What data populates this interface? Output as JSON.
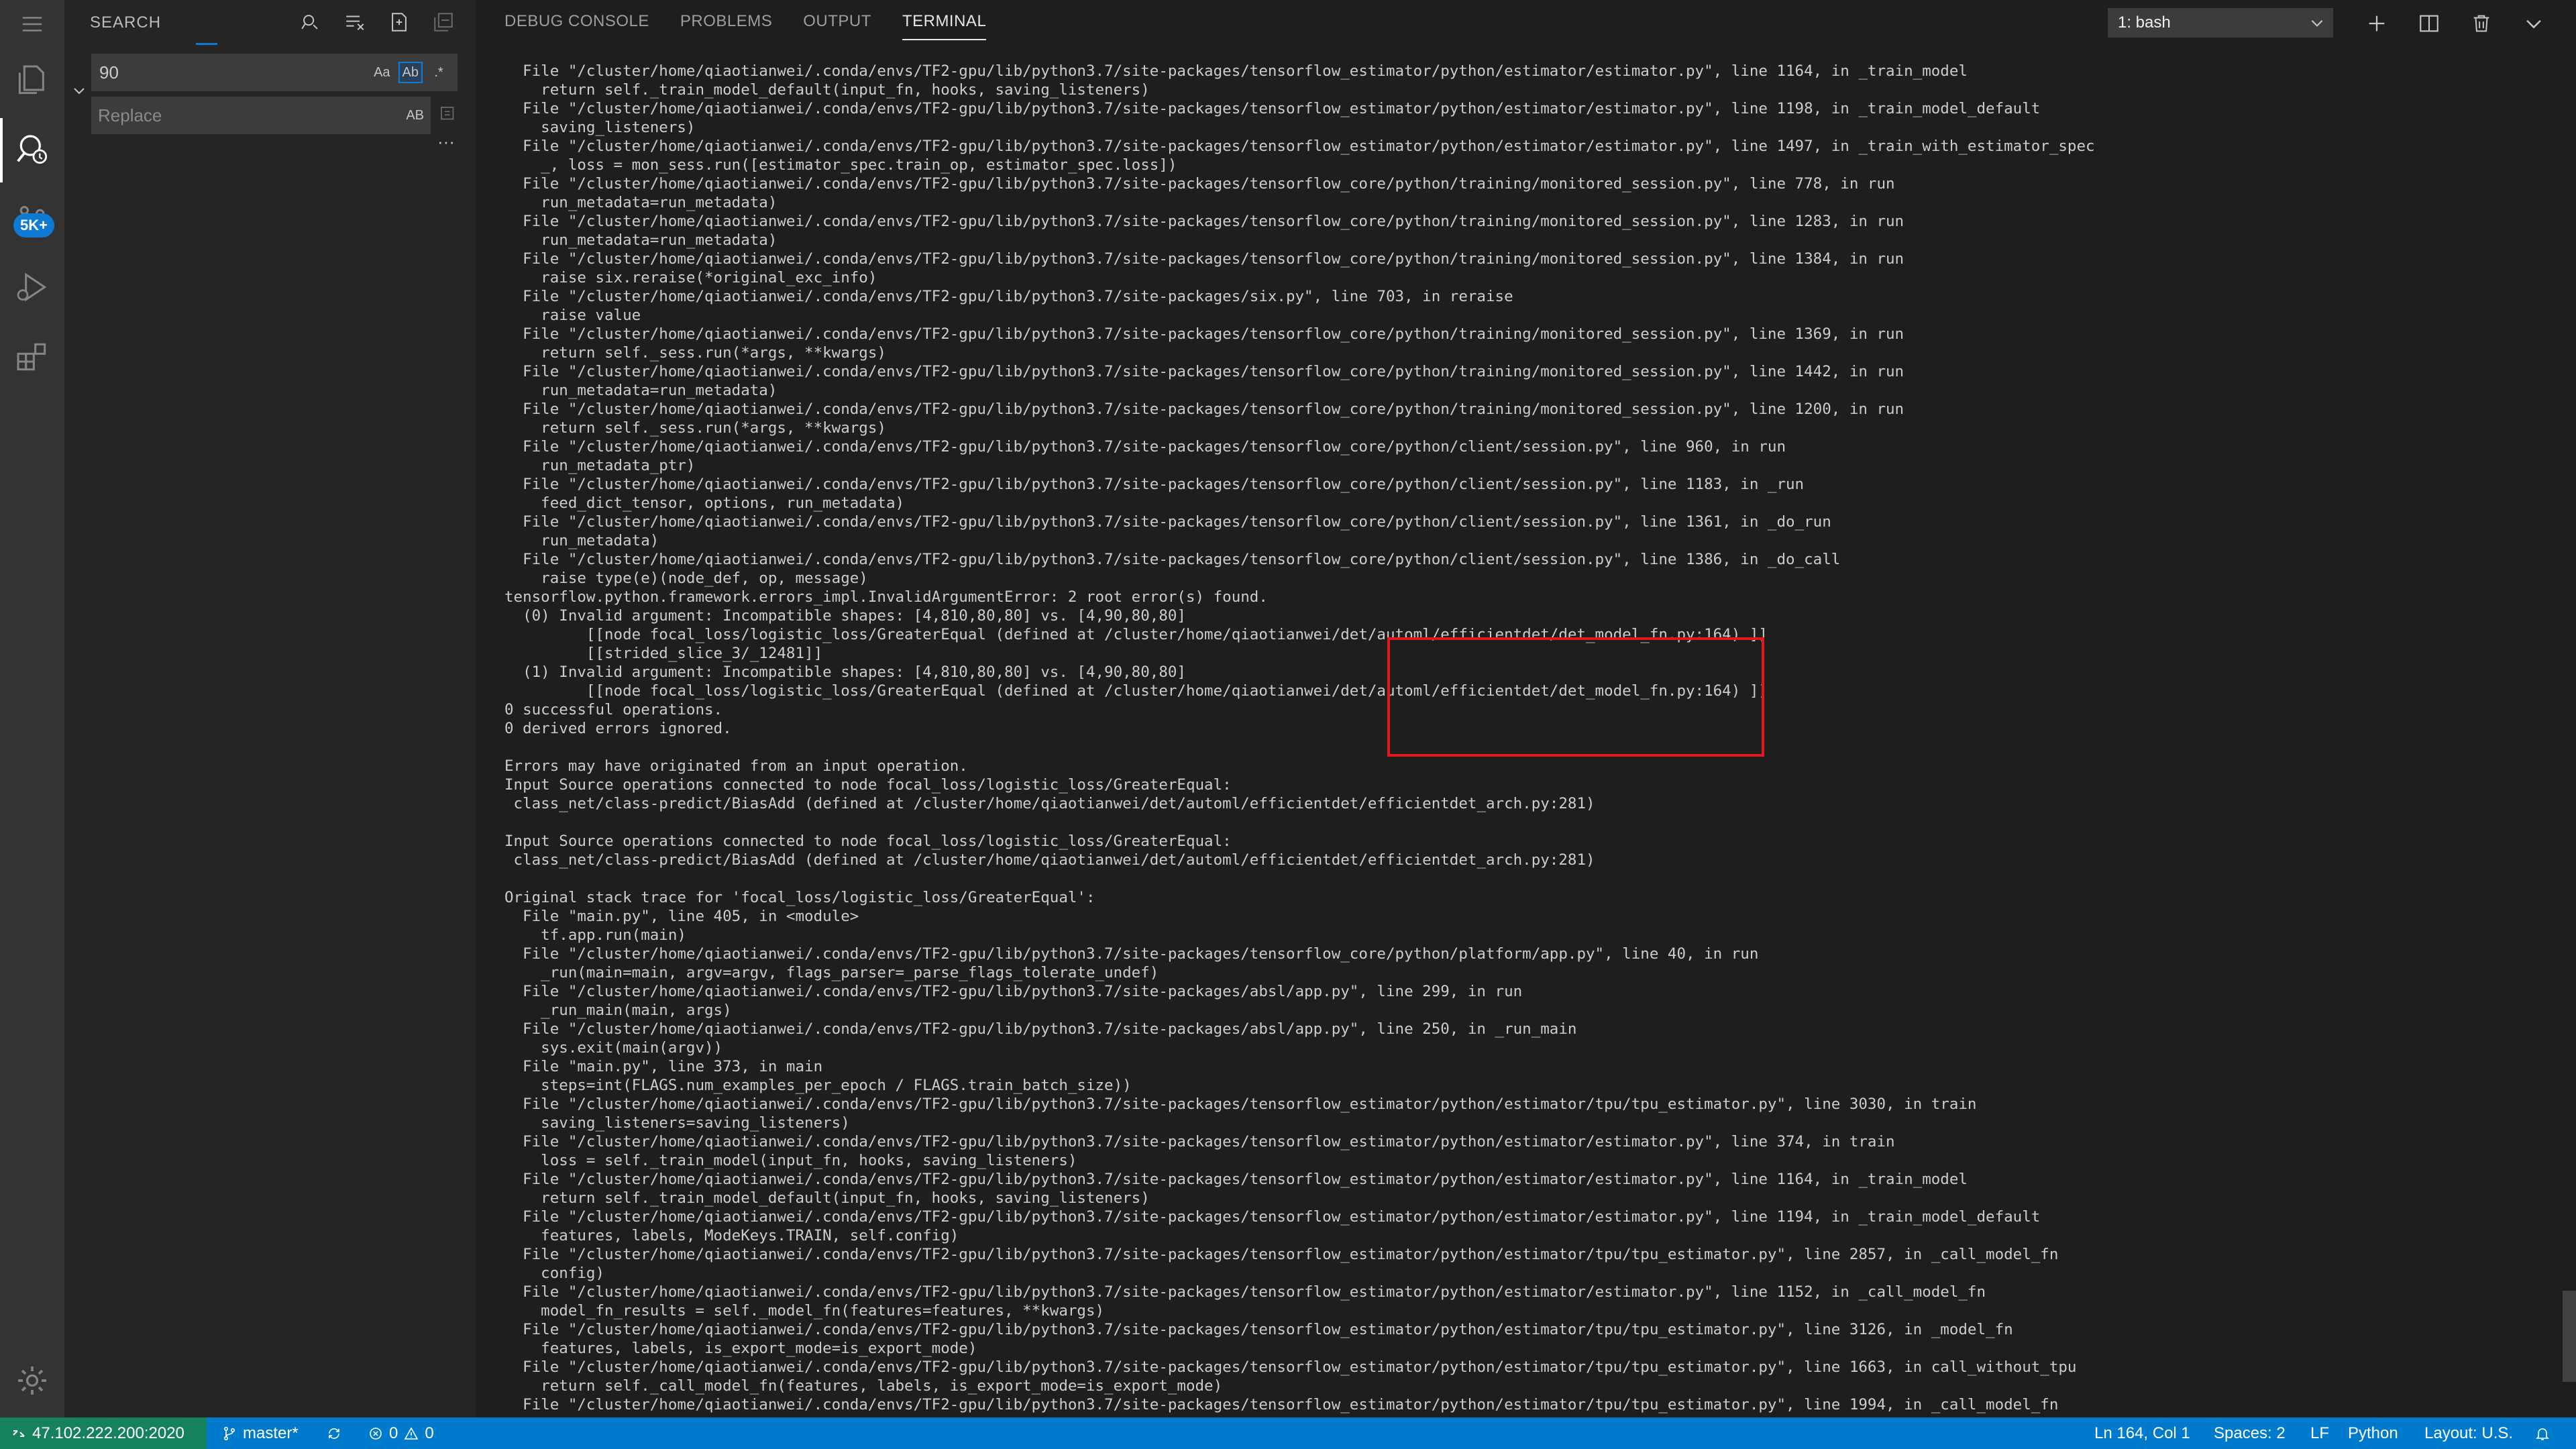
{
  "sidebar": {
    "title": "SEARCH",
    "search_value": "90",
    "replace_placeholder": "Replace",
    "options": {
      "match_case": "Aa",
      "whole_word": "Ab",
      "regex": ".*"
    },
    "replace_all": "AB",
    "more": "···"
  },
  "activity_bar": {
    "badge": "5K+"
  },
  "panel": {
    "tabs": [
      "DEBUG CONSOLE",
      "PROBLEMS",
      "OUTPUT",
      "TERMINAL"
    ],
    "active_tab": "TERMINAL",
    "terminal_select": "1: bash"
  },
  "terminal": {
    "lines": [
      "  File \"/cluster/home/qiaotianwei/.conda/envs/TF2-gpu/lib/python3.7/site-packages/tensorflow_estimator/python/estimator/estimator.py\", line 1164, in _train_model",
      "    return self._train_model_default(input_fn, hooks, saving_listeners)",
      "  File \"/cluster/home/qiaotianwei/.conda/envs/TF2-gpu/lib/python3.7/site-packages/tensorflow_estimator/python/estimator/estimator.py\", line 1198, in _train_model_default",
      "    saving_listeners)",
      "  File \"/cluster/home/qiaotianwei/.conda/envs/TF2-gpu/lib/python3.7/site-packages/tensorflow_estimator/python/estimator/estimator.py\", line 1497, in _train_with_estimator_spec",
      "    _, loss = mon_sess.run([estimator_spec.train_op, estimator_spec.loss])",
      "  File \"/cluster/home/qiaotianwei/.conda/envs/TF2-gpu/lib/python3.7/site-packages/tensorflow_core/python/training/monitored_session.py\", line 778, in run",
      "    run_metadata=run_metadata)",
      "  File \"/cluster/home/qiaotianwei/.conda/envs/TF2-gpu/lib/python3.7/site-packages/tensorflow_core/python/training/monitored_session.py\", line 1283, in run",
      "    run_metadata=run_metadata)",
      "  File \"/cluster/home/qiaotianwei/.conda/envs/TF2-gpu/lib/python3.7/site-packages/tensorflow_core/python/training/monitored_session.py\", line 1384, in run",
      "    raise six.reraise(*original_exc_info)",
      "  File \"/cluster/home/qiaotianwei/.conda/envs/TF2-gpu/lib/python3.7/site-packages/six.py\", line 703, in reraise",
      "    raise value",
      "  File \"/cluster/home/qiaotianwei/.conda/envs/TF2-gpu/lib/python3.7/site-packages/tensorflow_core/python/training/monitored_session.py\", line 1369, in run",
      "    return self._sess.run(*args, **kwargs)",
      "  File \"/cluster/home/qiaotianwei/.conda/envs/TF2-gpu/lib/python3.7/site-packages/tensorflow_core/python/training/monitored_session.py\", line 1442, in run",
      "    run_metadata=run_metadata)",
      "  File \"/cluster/home/qiaotianwei/.conda/envs/TF2-gpu/lib/python3.7/site-packages/tensorflow_core/python/training/monitored_session.py\", line 1200, in run",
      "    return self._sess.run(*args, **kwargs)",
      "  File \"/cluster/home/qiaotianwei/.conda/envs/TF2-gpu/lib/python3.7/site-packages/tensorflow_core/python/client/session.py\", line 960, in run",
      "    run_metadata_ptr)",
      "  File \"/cluster/home/qiaotianwei/.conda/envs/TF2-gpu/lib/python3.7/site-packages/tensorflow_core/python/client/session.py\", line 1183, in _run",
      "    feed_dict_tensor, options, run_metadata)",
      "  File \"/cluster/home/qiaotianwei/.conda/envs/TF2-gpu/lib/python3.7/site-packages/tensorflow_core/python/client/session.py\", line 1361, in _do_run",
      "    run_metadata)",
      "  File \"/cluster/home/qiaotianwei/.conda/envs/TF2-gpu/lib/python3.7/site-packages/tensorflow_core/python/client/session.py\", line 1386, in _do_call",
      "    raise type(e)(node_def, op, message)",
      "tensorflow.python.framework.errors_impl.InvalidArgumentError: 2 root error(s) found.",
      "  (0) Invalid argument: Incompatible shapes: [4,810,80,80] vs. [4,90,80,80]",
      "         [[node focal_loss/logistic_loss/GreaterEqual (defined at /cluster/home/qiaotianwei/det/automl/efficientdet/det_model_fn.py:164) ]]",
      "         [[strided_slice_3/_12481]]",
      "  (1) Invalid argument: Incompatible shapes: [4,810,80,80] vs. [4,90,80,80]",
      "         [[node focal_loss/logistic_loss/GreaterEqual (defined at /cluster/home/qiaotianwei/det/automl/efficientdet/det_model_fn.py:164) ]]",
      "0 successful operations.",
      "0 derived errors ignored.",
      "",
      "Errors may have originated from an input operation.",
      "Input Source operations connected to node focal_loss/logistic_loss/GreaterEqual:",
      " class_net/class-predict/BiasAdd (defined at /cluster/home/qiaotianwei/det/automl/efficientdet/efficientdet_arch.py:281)",
      "",
      "Input Source operations connected to node focal_loss/logistic_loss/GreaterEqual:",
      " class_net/class-predict/BiasAdd (defined at /cluster/home/qiaotianwei/det/automl/efficientdet/efficientdet_arch.py:281)",
      "",
      "Original stack trace for 'focal_loss/logistic_loss/GreaterEqual':",
      "  File \"main.py\", line 405, in <module>",
      "    tf.app.run(main)",
      "  File \"/cluster/home/qiaotianwei/.conda/envs/TF2-gpu/lib/python3.7/site-packages/tensorflow_core/python/platform/app.py\", line 40, in run",
      "    _run(main=main, argv=argv, flags_parser=_parse_flags_tolerate_undef)",
      "  File \"/cluster/home/qiaotianwei/.conda/envs/TF2-gpu/lib/python3.7/site-packages/absl/app.py\", line 299, in run",
      "    _run_main(main, args)",
      "  File \"/cluster/home/qiaotianwei/.conda/envs/TF2-gpu/lib/python3.7/site-packages/absl/app.py\", line 250, in _run_main",
      "    sys.exit(main(argv))",
      "  File \"main.py\", line 373, in main",
      "    steps=int(FLAGS.num_examples_per_epoch / FLAGS.train_batch_size))",
      "  File \"/cluster/home/qiaotianwei/.conda/envs/TF2-gpu/lib/python3.7/site-packages/tensorflow_estimator/python/estimator/tpu/tpu_estimator.py\", line 3030, in train",
      "    saving_listeners=saving_listeners)",
      "  File \"/cluster/home/qiaotianwei/.conda/envs/TF2-gpu/lib/python3.7/site-packages/tensorflow_estimator/python/estimator/estimator.py\", line 374, in train",
      "    loss = self._train_model(input_fn, hooks, saving_listeners)",
      "  File \"/cluster/home/qiaotianwei/.conda/envs/TF2-gpu/lib/python3.7/site-packages/tensorflow_estimator/python/estimator/estimator.py\", line 1164, in _train_model",
      "    return self._train_model_default(input_fn, hooks, saving_listeners)",
      "  File \"/cluster/home/qiaotianwei/.conda/envs/TF2-gpu/lib/python3.7/site-packages/tensorflow_estimator/python/estimator/estimator.py\", line 1194, in _train_model_default",
      "    features, labels, ModeKeys.TRAIN, self.config)",
      "  File \"/cluster/home/qiaotianwei/.conda/envs/TF2-gpu/lib/python3.7/site-packages/tensorflow_estimator/python/estimator/tpu/tpu_estimator.py\", line 2857, in _call_model_fn",
      "    config)",
      "  File \"/cluster/home/qiaotianwei/.conda/envs/TF2-gpu/lib/python3.7/site-packages/tensorflow_estimator/python/estimator/estimator.py\", line 1152, in _call_model_fn",
      "    model_fn_results = self._model_fn(features=features, **kwargs)",
      "  File \"/cluster/home/qiaotianwei/.conda/envs/TF2-gpu/lib/python3.7/site-packages/tensorflow_estimator/python/estimator/tpu/tpu_estimator.py\", line 3126, in _model_fn",
      "    features, labels, is_export_mode=is_export_mode)",
      "  File \"/cluster/home/qiaotianwei/.conda/envs/TF2-gpu/lib/python3.7/site-packages/tensorflow_estimator/python/estimator/tpu/tpu_estimator.py\", line 1663, in call_without_tpu",
      "    return self._call_model_fn(features, labels, is_export_mode=is_export_mode)",
      "  File \"/cluster/home/qiaotianwei/.conda/envs/TF2-gpu/lib/python3.7/site-packages/tensorflow_estimator/python/estimator/tpu/tpu_estimator.py\", line 1994, in _call_model_fn"
    ]
  },
  "statusbar": {
    "remote": "47.102.222.200:2020",
    "branch": "master*",
    "errors": "0",
    "warnings": "0",
    "position": "Ln 164, Col 1",
    "spaces": "Spaces: 2",
    "eol": "LF",
    "language": "Python",
    "layout": "Layout: U.S."
  },
  "colors": {
    "statusbar": "#007acc",
    "remote": "#16825d",
    "highlight": "#e0181c"
  }
}
